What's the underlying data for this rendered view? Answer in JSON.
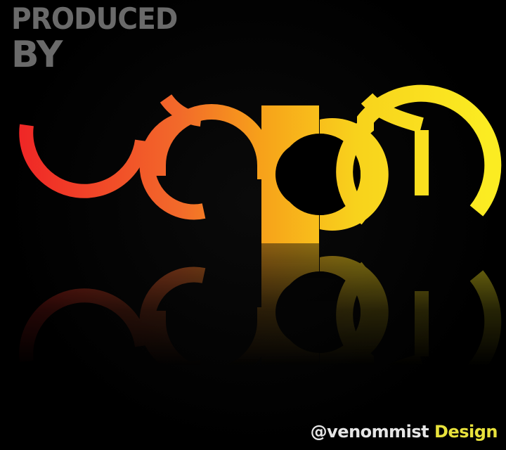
{
  "header": {
    "line1": "PRODUCED",
    "line2": "BY"
  },
  "logo": {
    "icon": "venom-logo",
    "gradient": [
      "#ef2426",
      "#f26a2a",
      "#f7a11a",
      "#f8d21c",
      "#fbec22"
    ]
  },
  "credit": {
    "handle": "@venommist",
    "tag": "Design",
    "handle_color": "#e6e6e6",
    "tag_color": "#e8e23c"
  }
}
